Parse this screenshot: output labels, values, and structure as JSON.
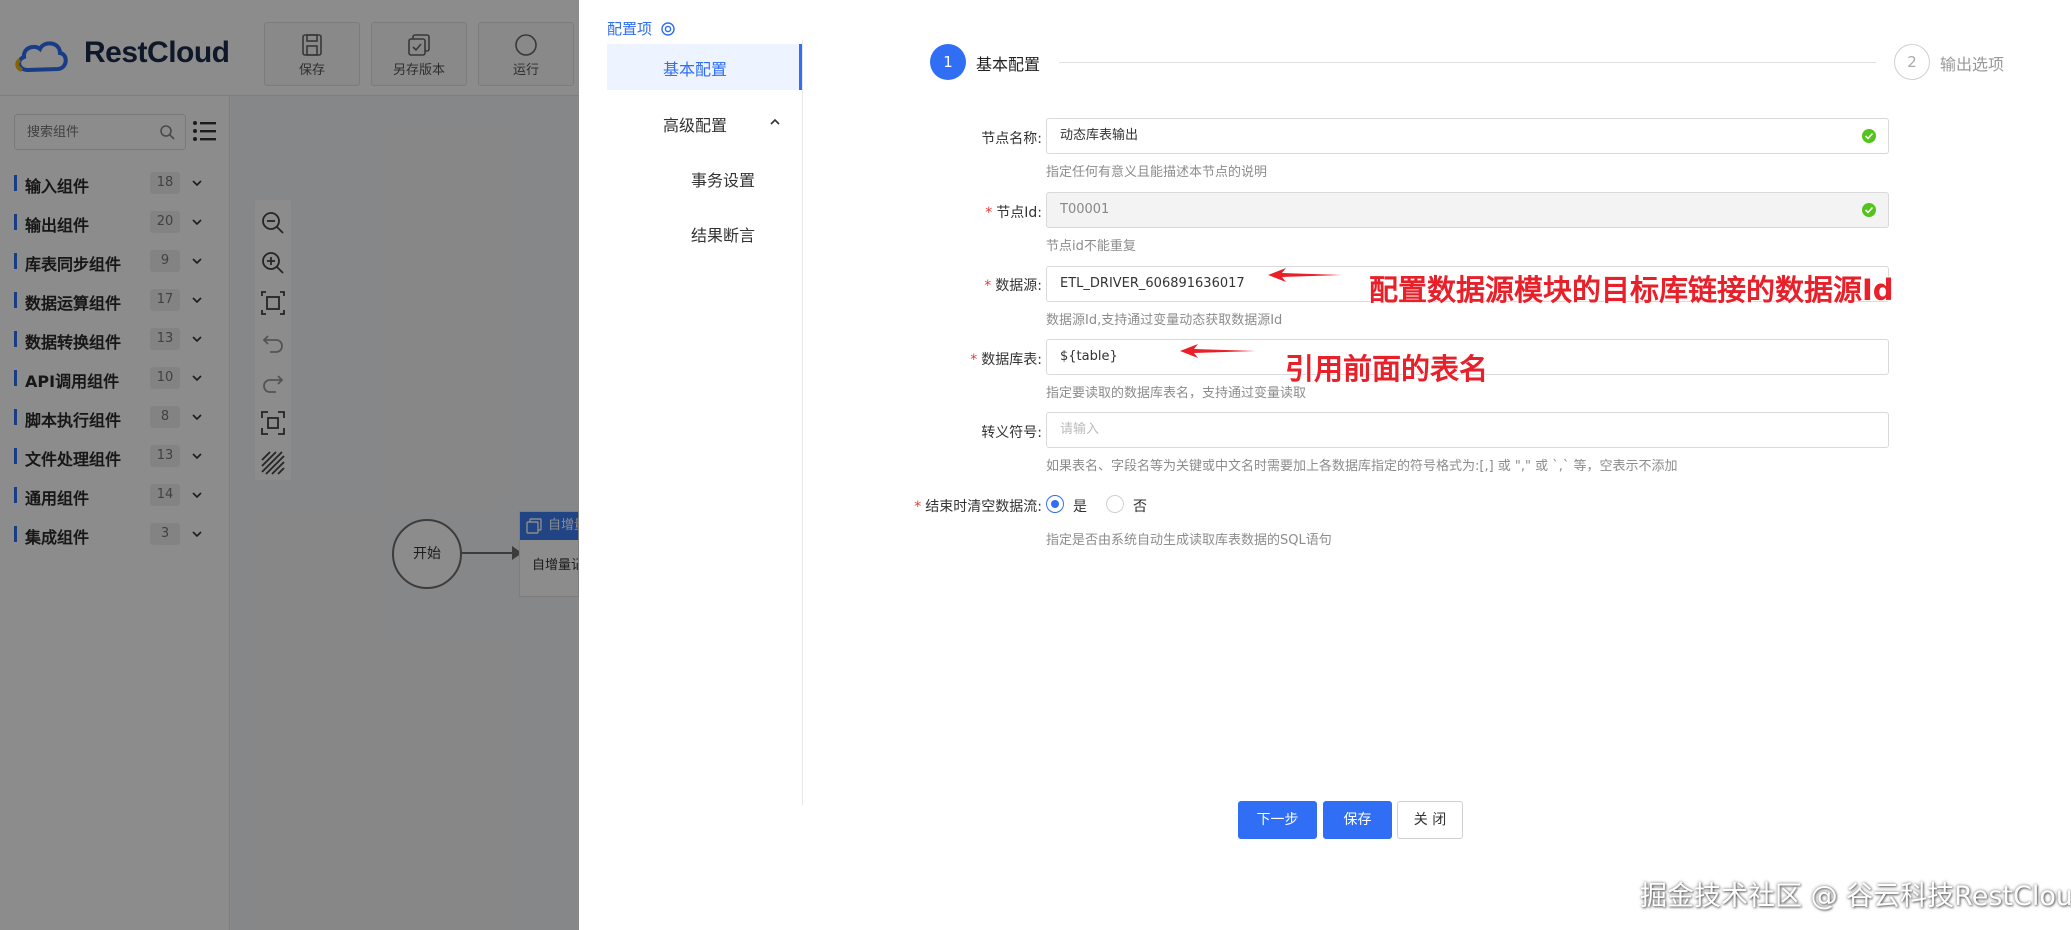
{
  "app": {
    "logo_text": "RestCloud",
    "toolbar": [
      {
        "label": "保存",
        "icon": "save-icon"
      },
      {
        "label": "另存版本",
        "icon": "save-version-icon"
      },
      {
        "label": "运行",
        "icon": "run-icon"
      }
    ],
    "search": {
      "placeholder": "搜索组件"
    },
    "categories": [
      {
        "name": "输入组件",
        "count": "18"
      },
      {
        "name": "输出组件",
        "count": "20"
      },
      {
        "name": "库表同步组件",
        "count": "9"
      },
      {
        "name": "数据运算组件",
        "count": "17"
      },
      {
        "name": "数据转换组件",
        "count": "13"
      },
      {
        "name": "API调用组件",
        "count": "10"
      },
      {
        "name": "脚本执行组件",
        "count": "8"
      },
      {
        "name": "文件处理组件",
        "count": "13"
      },
      {
        "name": "通用组件",
        "count": "14"
      },
      {
        "name": "集成组件",
        "count": "3"
      }
    ],
    "canvas": {
      "start_node": "开始",
      "card_header": "自增量",
      "card_body": "自增量记"
    }
  },
  "drawer": {
    "title": "配置项",
    "nav": {
      "basic": "基本配置",
      "advanced": "高级配置",
      "transaction": "事务设置",
      "assertion": "结果断言"
    },
    "steps": [
      {
        "num": "1",
        "label": "基本配置"
      },
      {
        "num": "2",
        "label": "输出选项"
      }
    ],
    "form": {
      "node_name": {
        "label": "节点名称:",
        "value": "动态库表输出",
        "hint": "指定任何有意义且能描述本节点的说明"
      },
      "node_id": {
        "label": "节点Id:",
        "value": "T00001",
        "hint": "节点id不能重复"
      },
      "datasource": {
        "label": "数据源:",
        "value": "ETL_DRIVER_606891636017",
        "hint": "数据源Id,支持通过变量动态获取数据源Id"
      },
      "table": {
        "label": "数据库表:",
        "value": "${table}",
        "hint": "指定要读取的数据库表名，支持通过变量读取"
      },
      "escape": {
        "label": "转义符号:",
        "placeholder": "请输入",
        "hint": "如果表名、字段名等为关键或中文名时需要加上各数据库指定的符号格式为:[,] 或 \",\" 或 `,` 等，空表示不添加"
      },
      "clear_stream": {
        "label": "结束时清空数据流:",
        "yes": "是",
        "no": "否",
        "selected": "yes",
        "hint": "指定是否由系统自动生成读取库表数据的SQL语句"
      }
    },
    "buttons": {
      "next": "下一步",
      "save": "保存",
      "close": "关 闭"
    }
  },
  "annotations": {
    "datasource_note": "配置数据源模块的目标库链接的数据源Id",
    "table_note": "引用前面的表名",
    "color": "#e8202a"
  },
  "watermark": "掘金技术社区 @ 谷云科技RestCloud",
  "colors": {
    "primary": "#2f6ef5",
    "success": "#52c41a",
    "required": "#e53935"
  }
}
